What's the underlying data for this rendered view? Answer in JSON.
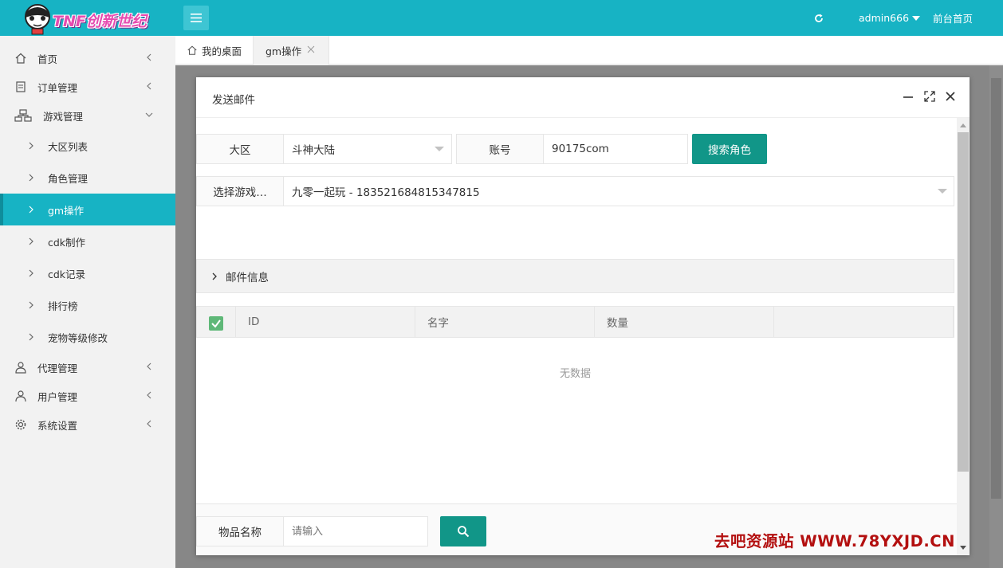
{
  "header": {
    "logo_text": "TNF创新世纪",
    "user": "admin666",
    "front_link": "前台首页"
  },
  "sidebar": {
    "items": [
      {
        "label": "首页"
      },
      {
        "label": "订单管理"
      },
      {
        "label": "游戏管理"
      },
      {
        "label": "代理管理"
      },
      {
        "label": "用户管理"
      },
      {
        "label": "系统设置"
      }
    ],
    "game_sub": [
      {
        "label": "大区列表"
      },
      {
        "label": "角色管理"
      },
      {
        "label": "gm操作"
      },
      {
        "label": "cdk制作"
      },
      {
        "label": "cdk记录"
      },
      {
        "label": "排行榜"
      },
      {
        "label": "宠物等级修改"
      }
    ]
  },
  "tabs": {
    "home": "我的桌面",
    "active": "gm操作"
  },
  "modal": {
    "title": "发送邮件",
    "region_label": "大区",
    "region_value": "斗神大陆",
    "account_label": "账号",
    "account_value": "90175com",
    "search_role_button": "搜索角色",
    "select_game_label": "选择游戏…",
    "select_game_value": "九零一起玩 - 183521684815347815",
    "mail_info": "邮件信息",
    "table": {
      "columns": [
        "ID",
        "名字",
        "数量",
        ""
      ],
      "empty_text": "无数据"
    },
    "item_name_label": "物品名称",
    "item_name_placeholder": "请输入"
  },
  "watermark": "去吧资源站  WWW.78YXJD.CN",
  "colors": {
    "primary": "#17b3c4",
    "button": "#119688",
    "checkbox": "#5fb878",
    "watermark": "#b30f0f"
  }
}
